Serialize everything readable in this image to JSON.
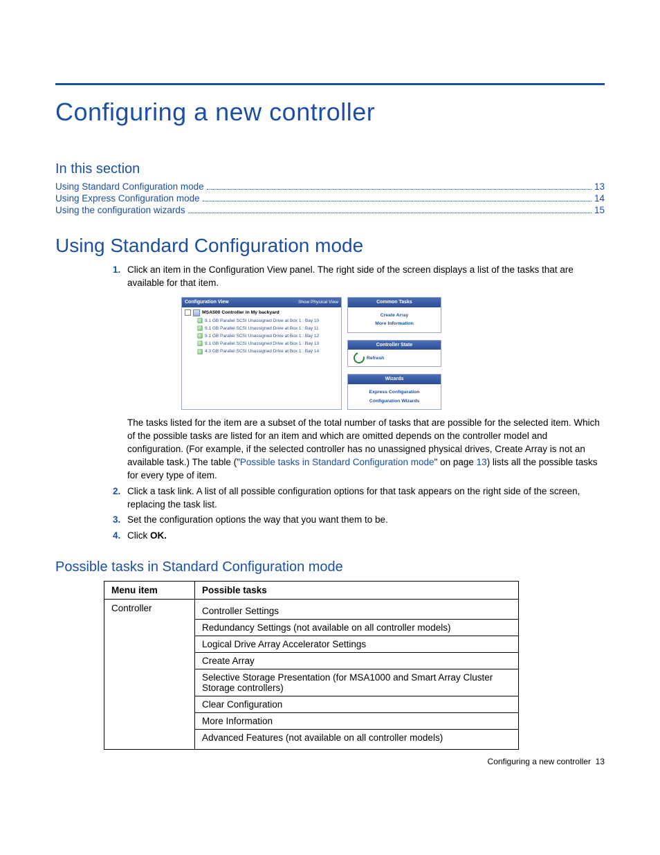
{
  "title": "Configuring a new controller",
  "section_label": "In this section",
  "toc": [
    {
      "label": "Using Standard Configuration mode",
      "page": "13"
    },
    {
      "label": "Using Express Configuration mode",
      "page": "14"
    },
    {
      "label": "Using the configuration wizards",
      "page": "15"
    }
  ],
  "h2": "Using Standard Configuration mode",
  "steps": {
    "s1": "Click an item in the Configuration View panel. The right side of the screen displays a list of the tasks that are available for that item.",
    "s2": "Click a task link. A list of all possible configuration options for that task appears on the right side of the screen, replacing the task list.",
    "s3": "Set the configuration options the way that you want them to be.",
    "s4_pre": "Click ",
    "s4_bold": "OK."
  },
  "mid_para": {
    "t1": "The tasks listed for the item are a subset of the total number of tasks that are possible for the selected item. Which of the possible tasks are listed for an item and which are omitted depends on the controller model and configuration. (For example, if the selected controller has no unassigned physical drives, Create Array is not an available task.) The table (\"",
    "link": "Possible tasks in Standard Configuration mode",
    "t2": "\" on page ",
    "pg": "13",
    "t3": ") lists all the possible tasks for every type of item."
  },
  "shot": {
    "left_title": "Configuration View",
    "left_sub": "Show Physical View",
    "root": "MSA500 Controller in My backyard",
    "rows": [
      "9.1 GB Parallel SCSI Unassigned Drive at Box 1 : Bay 10",
      "9.1 GB Parallel SCSI Unassigned Drive at Box 1 : Bay 11",
      "9.1 GB Parallel SCSI Unassigned Drive at Box 1 : Bay 12",
      "9.1 GB Parallel SCSI Unassigned Drive at Box 1 : Bay 13",
      "4.3 GB Parallel SCSI Unassigned Drive at Box 1 : Bay 14"
    ],
    "r1_title": "Common Tasks",
    "r1_a": "Create Array",
    "r1_b": "More Information",
    "r2_title": "Controller State",
    "r2_a": "Refresh",
    "r3_title": "Wizards",
    "r3_a": "Express Configuration",
    "r3_b": "Configuration Wizards"
  },
  "h3": "Possible tasks in Standard Configuration mode",
  "table": {
    "h1": "Menu item",
    "h2": "Possible tasks",
    "menu": "Controller",
    "tasks": [
      "Controller Settings",
      "Redundancy Settings (not available on all controller models)",
      "Logical Drive Array Accelerator Settings",
      "Create Array",
      "Selective Storage Presentation (for MSA1000 and Smart Array Cluster Storage controllers)",
      "Clear Configuration",
      "More Information",
      "Advanced Features (not available on all controller models)"
    ]
  },
  "footer": {
    "label": "Configuring a new controller",
    "page": "13"
  }
}
